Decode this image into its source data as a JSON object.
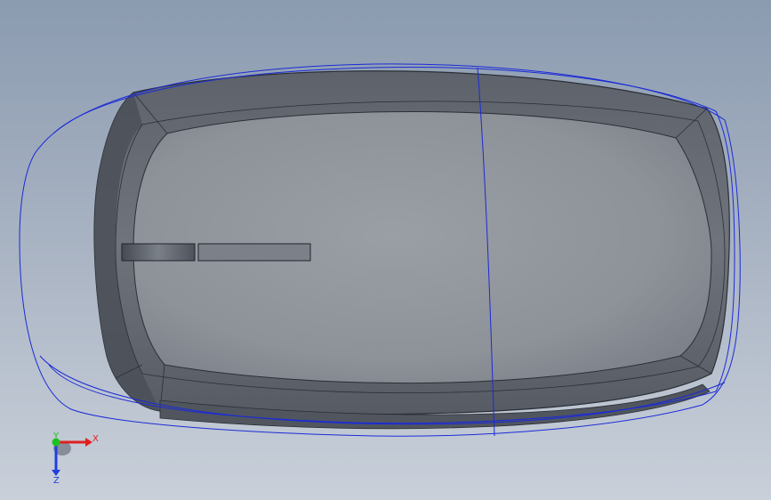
{
  "viewport": {
    "background_top": "#8b9bb0",
    "background_bottom": "#c9d0da",
    "model_fill": "#8f949c",
    "model_edge": "#2b2f36",
    "wireframe_color": "#1b2bd6"
  },
  "triad": {
    "x_label": "X",
    "y_label": "Y",
    "z_label": "Z",
    "x_color": "#e02020",
    "y_color": "#20c020",
    "z_color": "#2040e0"
  }
}
